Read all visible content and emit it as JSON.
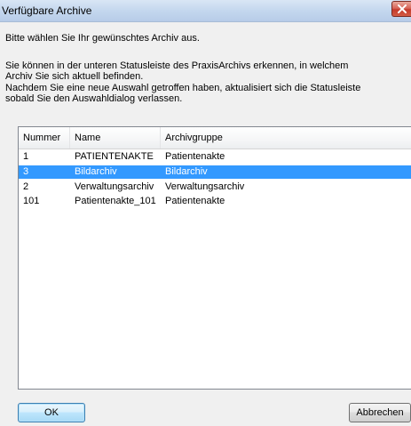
{
  "window": {
    "title": "Verfügbare Archive"
  },
  "instructions": {
    "line1": "Bitte wählen Sie Ihr gewünschtes Archiv aus.",
    "line2": "Sie können in der unteren Statusleiste des PraxisArchivs erkennen, in welchem",
    "line3": "Archiv Sie sich aktuell befinden.",
    "line4": "Nachdem Sie  eine neue Auswahl getroffen haben, aktualisiert sich die Statusleiste",
    "line5": "sobald Sie den Auswahldialog verlassen."
  },
  "archive_list": {
    "columns": [
      "Nummer",
      "Name",
      "Archivgruppe"
    ],
    "rows": [
      {
        "nummer": "1",
        "name": "PATIENTENAKTE",
        "gruppe": "Patientenakte",
        "selected": false
      },
      {
        "nummer": "3",
        "name": "Bildarchiv",
        "gruppe": "Bildarchiv",
        "selected": true
      },
      {
        "nummer": "2",
        "name": "Verwaltungsarchiv",
        "gruppe": "Verwaltungsarchiv",
        "selected": false
      },
      {
        "nummer": "101",
        "name": "Patientenakte_101",
        "gruppe": "Patientenakte",
        "selected": false
      }
    ]
  },
  "buttons": {
    "ok_label": "OK",
    "cancel_label": "Abbrechen"
  },
  "colors": {
    "selection": "#3399ff",
    "close_button": "#c43b2c"
  },
  "icons": {
    "close": "close-icon"
  }
}
